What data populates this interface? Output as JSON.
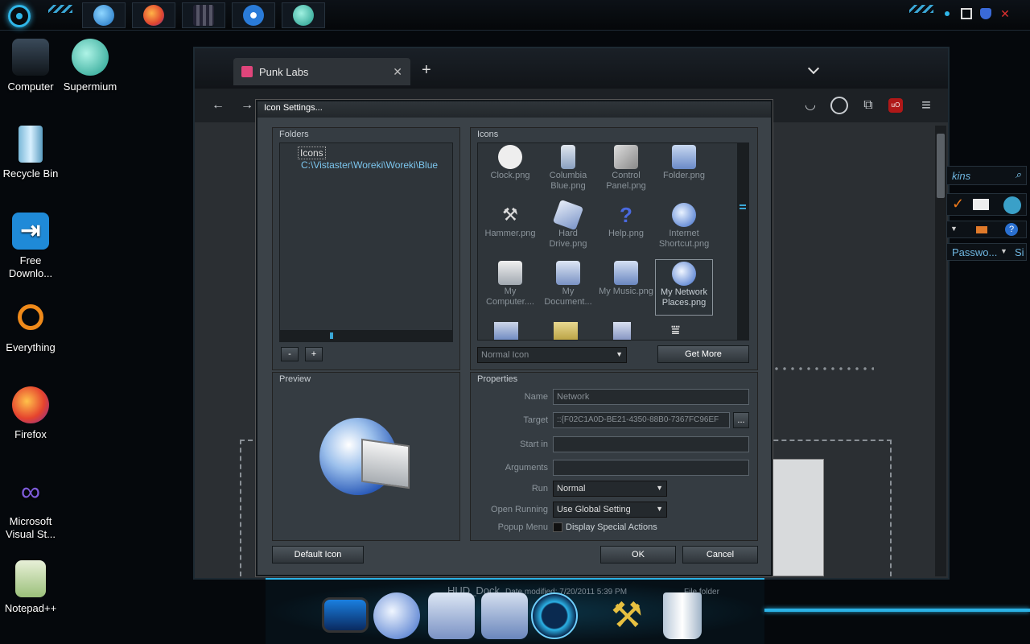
{
  "taskbar": {
    "apps": [
      "internet-explorer",
      "firefox",
      "film",
      "media-player",
      "supermium"
    ]
  },
  "desktop": {
    "icons": [
      {
        "label": "Computer"
      },
      {
        "label": "Supermium"
      },
      {
        "label": "Recycle Bin"
      },
      {
        "label": "Free Downlo..."
      },
      {
        "label": "Everything"
      },
      {
        "label": "Firefox"
      },
      {
        "label": "Microsoft Visual St..."
      },
      {
        "label": "Notepad++"
      }
    ]
  },
  "browser": {
    "tab_title": "Punk Labs",
    "tab_close": "✕",
    "new_tab": "+",
    "menu_glyph": "≡",
    "addon_badge": "uO"
  },
  "right_fragment": {
    "search_text": "kins",
    "password_text": "Passwo...",
    "si_text": "Si"
  },
  "dialog": {
    "title": "Icon Settings...",
    "folders_label": "Folders",
    "folders_tree": [
      "Icons",
      "C:\\Vistaster\\Woreki\\Woreki\\Blue"
    ],
    "minus": "-",
    "plus": "+",
    "icons_label": "Icons",
    "icons": [
      {
        "label": "Clock.png"
      },
      {
        "label": "Columbia Blue.png"
      },
      {
        "label": "Control Panel.png"
      },
      {
        "label": "Folder.png"
      },
      {
        "label": "Hammer.png"
      },
      {
        "label": "Hard Drive.png"
      },
      {
        "label": "Help.png"
      },
      {
        "label": "Internet Shortcut.png"
      },
      {
        "label": "My Computer...."
      },
      {
        "label": "My Document..."
      },
      {
        "label": "My Music.png"
      },
      {
        "label": "My Network Places.png"
      }
    ],
    "icon_mode": "Normal Icon",
    "get_more": "Get More",
    "preview_label": "Preview",
    "properties_label": "Properties",
    "properties": {
      "name_label": "Name",
      "name_value": "Network",
      "target_label": "Target",
      "target_value": "::{F02C1A0D-BE21-4350-88B0-7367FC96EF",
      "browse": "...",
      "start_in_label": "Start in",
      "start_in_value": "",
      "arguments_label": "Arguments",
      "arguments_value": "",
      "run_label": "Run",
      "run_value": "Normal",
      "open_running_label": "Open Running",
      "open_running_value": "Use Global Setting",
      "popup_menu_label": "Popup Menu",
      "popup_menu_checkbox": "Display Special Actions"
    },
    "default_icon": "Default Icon",
    "ok": "OK",
    "cancel": "Cancel"
  },
  "dock": {
    "title": "HUD_Dock",
    "date_fragment": "Date modified: 7/20/2011 5:39 PM",
    "type_fragment": "File folder"
  },
  "colors": {
    "accent": "#2fb6e8",
    "dialog_bg": "#3b4248",
    "browser_bg": "#2b2f33"
  }
}
